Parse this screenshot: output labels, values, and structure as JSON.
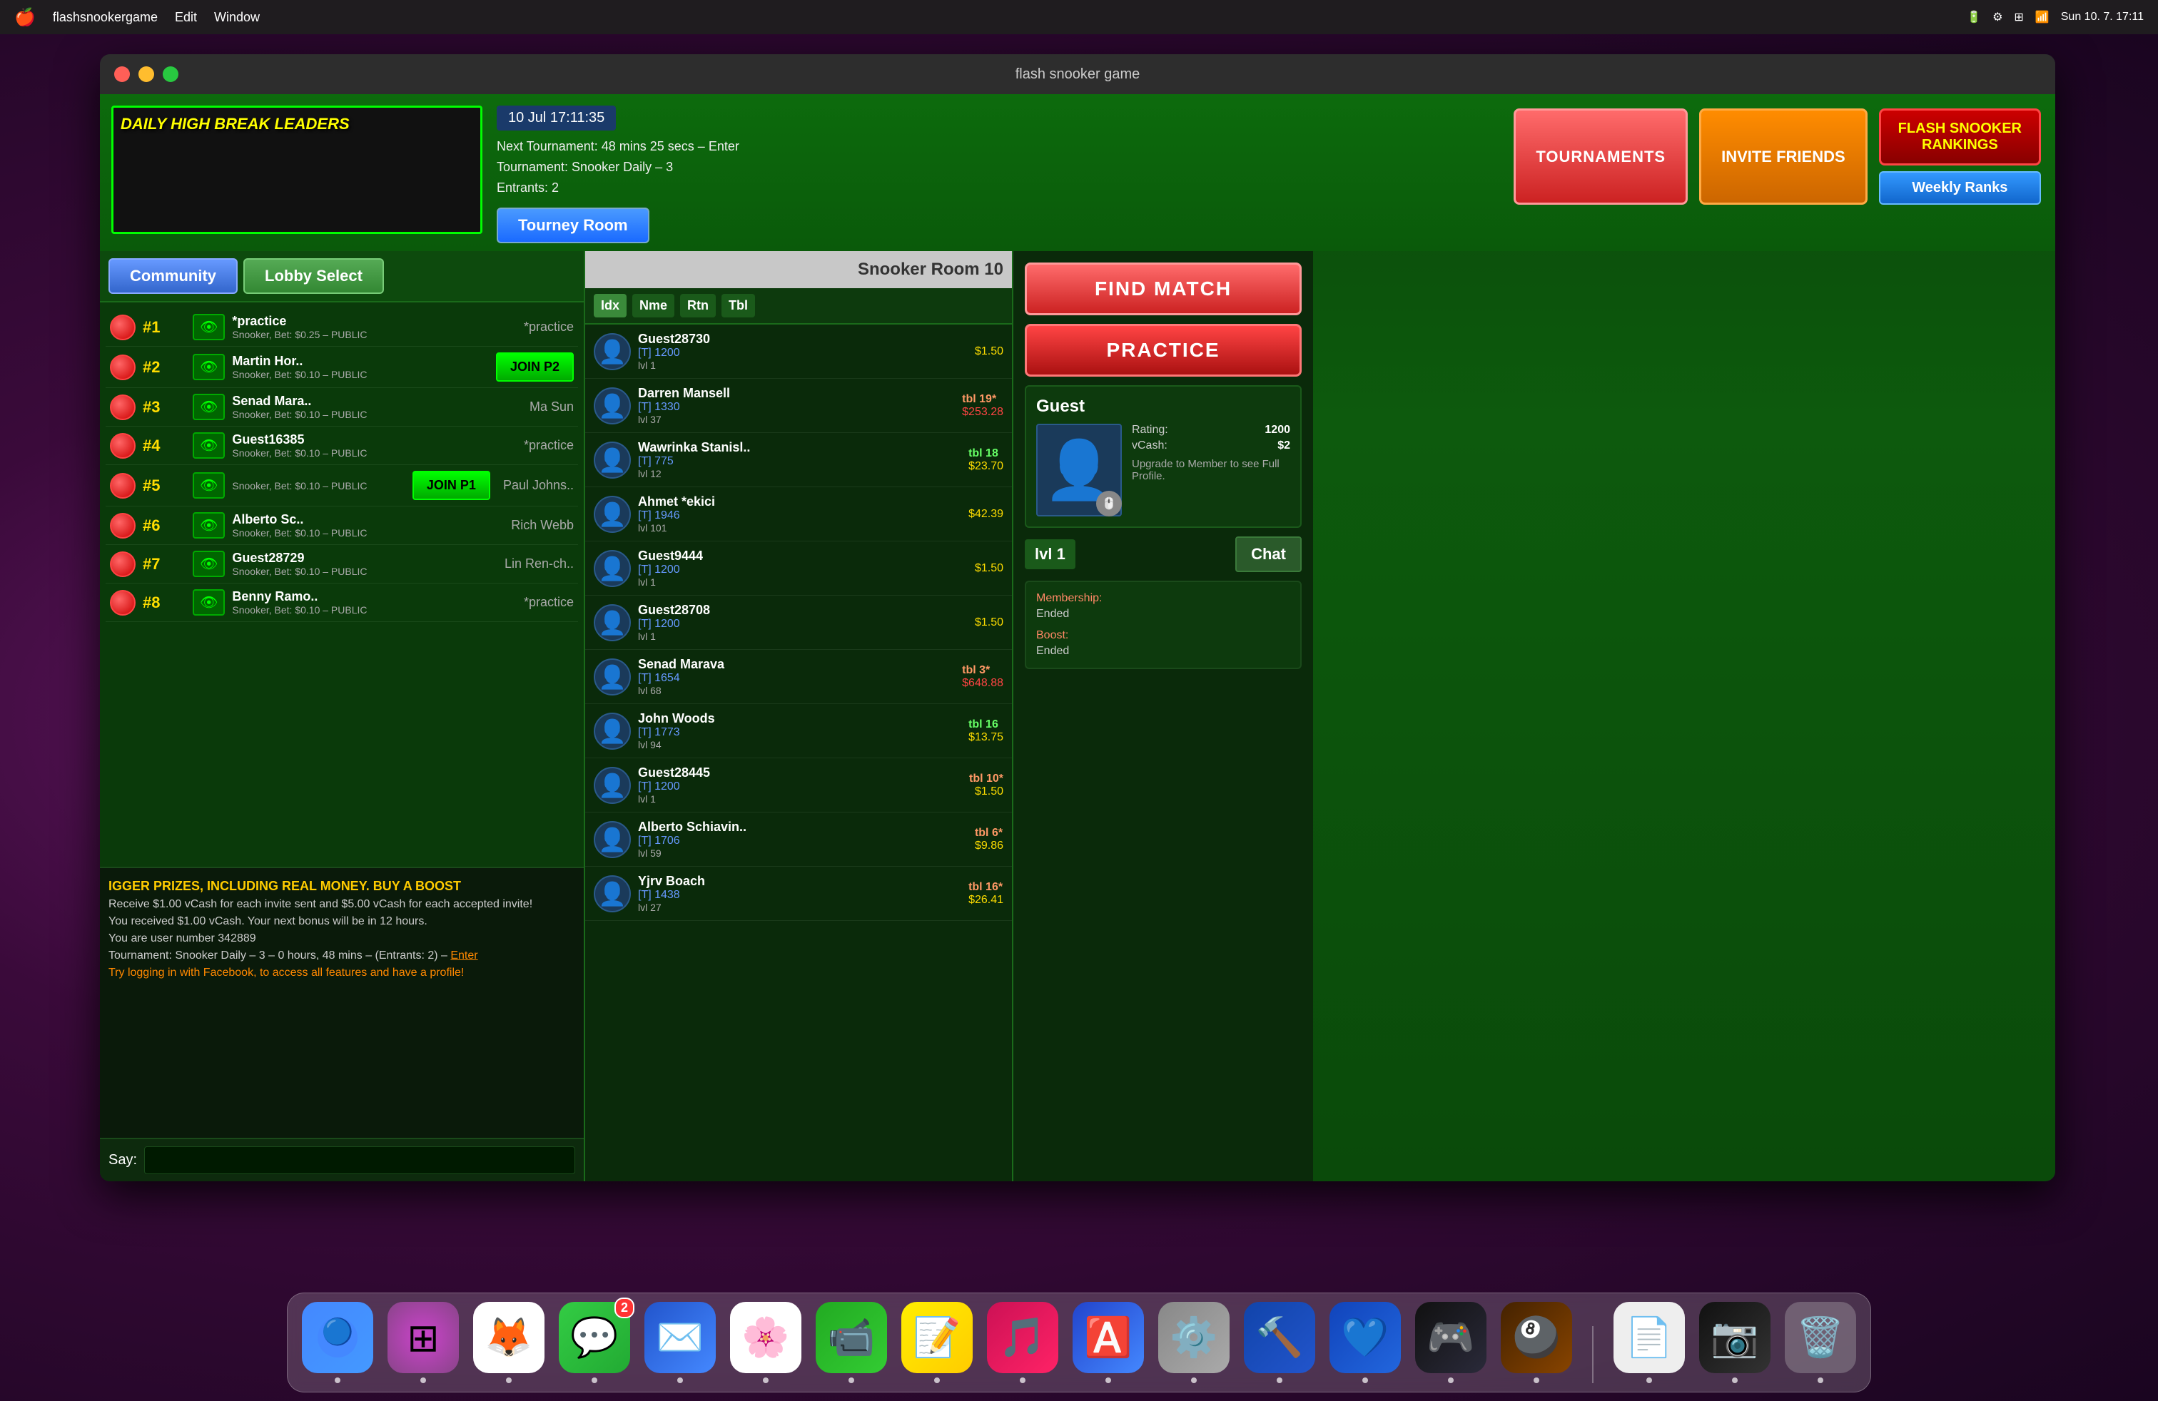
{
  "menubar": {
    "apple": "🍎",
    "app": "flashsnookergame",
    "edit": "Edit",
    "window": "Window",
    "time": "Sun 10. 7.  17:11"
  },
  "window": {
    "title": "flash snooker game"
  },
  "header": {
    "daily_break_title": "DAILY HIGH BREAK LEADERS",
    "date": "10 Jul 17:11:35",
    "tournament_line1": "Next Tournament: 48 mins 25 secs – Enter",
    "tournament_line2": "Tournament: Snooker Daily – 3",
    "tournament_line3": "Entrants: 2",
    "tourney_room_btn": "Tourney Room",
    "btn_tournaments": "TOURNAMENTS",
    "btn_invite": "INVITE FRIENDS",
    "btn_rankings_line1": "FLASH SNOOKER",
    "btn_rankings_line2": "RANKINGS",
    "btn_weekly": "Weekly Ranks"
  },
  "lobby": {
    "tab_community": "Community",
    "tab_lobby_select": "Lobby Select",
    "players": [
      {
        "num": "#1",
        "name": "*practice",
        "action": "*practice",
        "bet": "Snooker, Bet: $0.25 – PUBLIC"
      },
      {
        "num": "#2",
        "name": "Martin Hor..",
        "action": "JOIN P2",
        "bet": "Snooker, Bet: $0.10 – PUBLIC"
      },
      {
        "num": "#3",
        "name": "Senad Mara..",
        "action": "Ma Sun",
        "bet": "Snooker, Bet: $0.10 – PUBLIC"
      },
      {
        "num": "#4",
        "name": "Guest16385",
        "action": "*practice",
        "bet": "Snooker, Bet: $0.10 – PUBLIC"
      },
      {
        "num": "#5",
        "name": "JOIN P1",
        "action": "Paul Johns..",
        "bet": "Snooker, Bet: $0.10 – PUBLIC"
      },
      {
        "num": "#6",
        "name": "Alberto Sc..",
        "action": "Rich Webb",
        "bet": "Snooker, Bet: $0.10 – PUBLIC"
      },
      {
        "num": "#7",
        "name": "Guest28729",
        "action": "Lin Ren-ch..",
        "bet": "Snooker, Bet: $0.10 – PUBLIC"
      },
      {
        "num": "#8",
        "name": "Benny Ramo..",
        "action": "*practice",
        "bet": "Snooker, Bet: $0.10 – PUBLIC"
      }
    ],
    "chat_messages": [
      "IGGER PRIZES, INCLUDING REAL MONEY. BUY A BOOST",
      "Receive $1.00 vCash for each invite sent and $5.00 vCash for each accepted invite!",
      "You received $1.00 vCash. Your next bonus will be in 12 hours.",
      "You are user number 342889",
      "Tournament: Snooker Daily – 3 – 0 hours, 48 mins – (Entrants: 2) – Enter",
      "Try logging in with Facebook, to access all features and have a profile!"
    ],
    "say_label": "Say:"
  },
  "table_headers": {
    "idx": "Idx",
    "nme": "Nme",
    "rtn": "Rtn",
    "tbl": "Tbl"
  },
  "room_label": "Snooker Room 10",
  "online_players": [
    {
      "name": "Guest28730",
      "rating": "[T] 1200",
      "level": "lvl 1",
      "badge": "",
      "money": "$1.50"
    },
    {
      "name": "Darren Mansell",
      "rating": "[T] 1330",
      "level": "lvl 37",
      "badge": "tbl 19*",
      "money": "$253.28"
    },
    {
      "name": "Wawrinka Stanisl..",
      "rating": "[T] 775",
      "level": "lvl 12",
      "badge": "tbl 18",
      "money": "$23.70"
    },
    {
      "name": "Ahmet *ekici",
      "rating": "[T] 1946",
      "level": "lvl 101",
      "badge": "",
      "money": "$42.39"
    },
    {
      "name": "Guest9444",
      "rating": "[T] 1200",
      "level": "lvl 1",
      "badge": "",
      "money": "$1.50"
    },
    {
      "name": "Guest28708",
      "rating": "[T] 1200",
      "level": "lvl 1",
      "badge": "",
      "money": "$1.50"
    },
    {
      "name": "Senad Marava",
      "rating": "[T] 1654",
      "level": "lvl 68",
      "badge": "tbl 3*",
      "money": "$648.88"
    },
    {
      "name": "John Woods",
      "rating": "[T] 1773",
      "level": "lvl 94",
      "badge": "tbl 16",
      "money": "$13.75"
    },
    {
      "name": "Guest28445",
      "rating": "[T] 1200",
      "level": "lvl 1",
      "badge": "tbl 10*",
      "money": "$1.50"
    },
    {
      "name": "Alberto Schiavin..",
      "rating": "[T] 1706",
      "level": "lvl 59",
      "badge": "tbl 6*",
      "money": "$9.86"
    },
    {
      "name": "Yjrv Boach",
      "rating": "[T] 1438",
      "level": "lvl 27",
      "badge": "tbl 16*",
      "money": "$26.41"
    }
  ],
  "profile": {
    "guest_name": "Guest",
    "rating_label": "Rating:",
    "rating_value": "1200",
    "vcash_label": "vCash:",
    "vcash_value": "$2",
    "upgrade_msg": "Upgrade to Member to see Full Profile.",
    "level": "lvl 1",
    "chat_btn": "Chat",
    "membership_label": "Membership:",
    "membership_value": "Ended",
    "boost_label": "Boost:",
    "boost_value": "Ended"
  },
  "action_buttons": {
    "find_match": "FIND MATCH",
    "practice": "PRACTICE"
  },
  "dock": {
    "items": [
      {
        "name": "finder",
        "color": "#4a9aff",
        "emoji": "🔵",
        "bg": "#4a9aff"
      },
      {
        "name": "launchpad",
        "color": "#ff6b35",
        "emoji": "🟠",
        "bg": "#ff6b35"
      },
      {
        "name": "firefox",
        "color": "#ff6600",
        "emoji": "🦊",
        "bg": "#fff"
      },
      {
        "name": "messages",
        "color": "#33cc33",
        "emoji": "💬",
        "bg": "#33cc33",
        "badge": "2"
      },
      {
        "name": "mail",
        "color": "#4488ff",
        "emoji": "✉️",
        "bg": "#fff"
      },
      {
        "name": "photos",
        "color": "#ff4488",
        "emoji": "🌸",
        "bg": "#fff"
      },
      {
        "name": "facetime",
        "color": "#33cc33",
        "emoji": "📹",
        "bg": "#33cc33"
      },
      {
        "name": "notes",
        "color": "#ffee00",
        "emoji": "📝",
        "bg": "#ffee00"
      },
      {
        "name": "music",
        "color": "#ff2266",
        "emoji": "🎵",
        "bg": "#ff2266"
      },
      {
        "name": "appstore",
        "color": "#4488ff",
        "emoji": "🅰️",
        "bg": "#fff"
      },
      {
        "name": "settings",
        "color": "#888888",
        "emoji": "⚙️",
        "bg": "#888"
      },
      {
        "name": "xcode",
        "color": "#4488ff",
        "emoji": "🔨",
        "bg": "#4488ff"
      },
      {
        "name": "vscode",
        "color": "#2255ff",
        "emoji": "💙",
        "bg": "#2255ff"
      },
      {
        "name": "steam",
        "color": "#1a1a2a",
        "emoji": "🎮",
        "bg": "#1a1a2a"
      },
      {
        "name": "snooker",
        "color": "#cc4400",
        "emoji": "🎱",
        "bg": "#cc4400"
      },
      {
        "name": "files",
        "color": "#ffffff",
        "emoji": "📄",
        "bg": "#ffffff"
      },
      {
        "name": "capture",
        "color": "#ff4444",
        "emoji": "📷",
        "bg": "#222"
      },
      {
        "name": "trash",
        "color": "#888888",
        "emoji": "🗑️",
        "bg": "#888"
      }
    ]
  }
}
